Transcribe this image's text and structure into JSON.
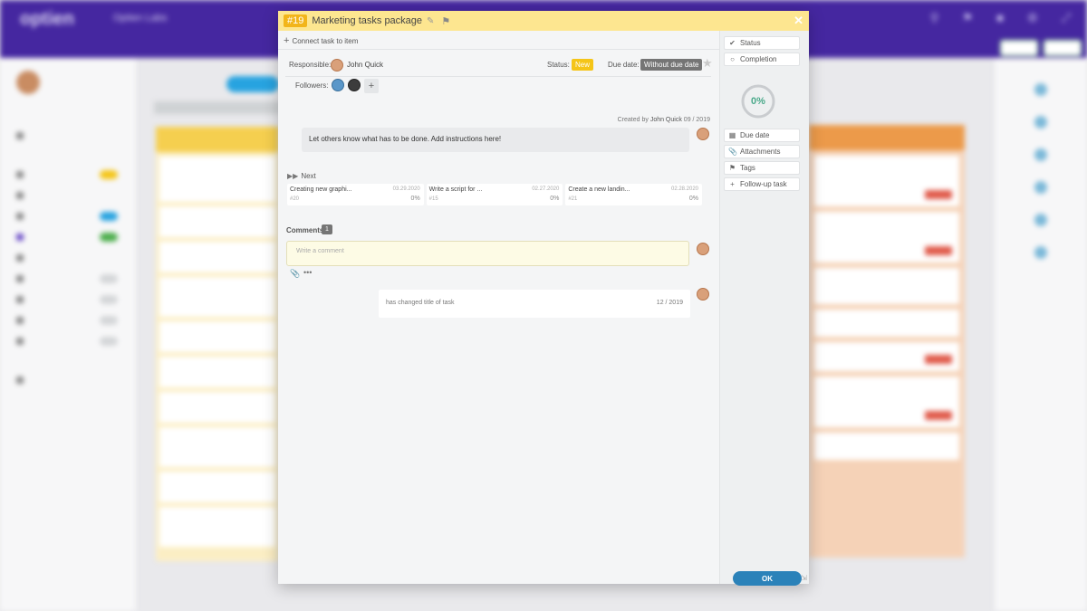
{
  "app": {
    "logo": "optien",
    "company": "Optien Labs"
  },
  "modal": {
    "task_number": "#19",
    "task_title": "Marketing tasks package",
    "connect_label": "Connect task to item",
    "responsible_label": "Responsible:",
    "responsible_name": "John Quick",
    "status_label": "Status:",
    "status_value": "New",
    "due_label": "Due date:",
    "due_value": "Without due date",
    "followers_label": "Followers:",
    "created_by_prefix": "Created by",
    "created_by_name": "John Quick",
    "created_by_date": "09 / 2019",
    "description": "Let others know what has to be done. Add instructions here!",
    "next_label": "Next",
    "next_items": [
      {
        "title": "Creating new graphi...",
        "date": "03.29.2020",
        "id": "#20",
        "progress": "0%"
      },
      {
        "title": "Write a script for ...",
        "date": "02.27.2020",
        "id": "#15",
        "progress": "0%"
      },
      {
        "title": "Create a new landin...",
        "date": "02.28.2020",
        "id": "#21",
        "progress": "0%"
      }
    ],
    "comments_label": "Comments",
    "comments_count": "1",
    "comment_placeholder": "Write a comment",
    "activity_text": "has changed title of task",
    "activity_date": "12 / 2019"
  },
  "side_panel": {
    "status_label": "Status",
    "completion_label": "Completion",
    "completion_value": "0%",
    "completion_fraction": 0,
    "due_date_label": "Due date",
    "attachments_label": "Attachments",
    "tags_label": "Tags",
    "follow_up_label": "Follow-up task",
    "ok_label": "OK"
  },
  "colors": {
    "header": "#fde690",
    "task_number_badge": "#f2b51a",
    "status_badge": "#f5c518",
    "ok_button": "#2b82b9",
    "completion": "#4aa98a",
    "top_bar": "#4527a0"
  },
  "icons": [
    "plus-icon",
    "pencil-icon",
    "flag-icon",
    "close-icon",
    "star-icon",
    "next-icon",
    "attachment-icon",
    "more-icon",
    "check-icon",
    "circle-icon",
    "calendar-icon",
    "paperclip-icon",
    "tag-icon",
    "resize-icon"
  ]
}
